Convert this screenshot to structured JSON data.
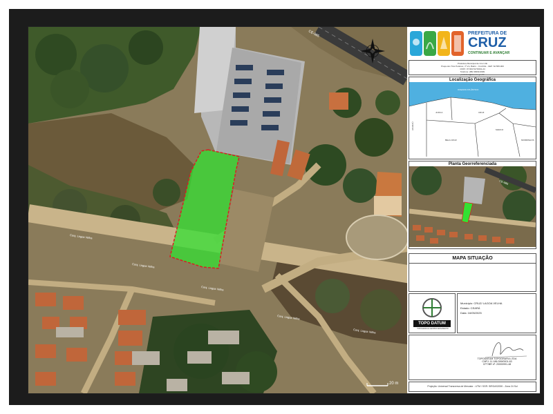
{
  "header": {
    "org_top": "PREFEITURA DE",
    "org_name": "CRUZ",
    "slogan": "CONTINUAR E AVANÇAR"
  },
  "agency_info": {
    "lines": [
      "Prefeitura Municipal de Cruz-CE",
      "Praça dos Três Poderes, nº s/n, Bairro - Cruz/CE - CEP: 62.595-000",
      "CNPJ: 07.693.517/0001-24",
      "Telefone: (88) 99999-9999",
      "prefeitura@cruz.ce.gov.br"
    ]
  },
  "geo_location": {
    "title": "Localização Geográfica",
    "labels": [
      "OCEANO ATLÂNTICO",
      "ACARAÚ",
      "JIJOCA",
      "BELA CRUZ",
      "MARCO",
      "MORRINHOS",
      "CRUZ"
    ]
  },
  "georef_plan": {
    "title": "Planta Georreferenciada",
    "road_label": "CE-085"
  },
  "situation_map": {
    "title": "MAPA SITUAÇÃO"
  },
  "company": {
    "name": "TOPO DATUM",
    "tagline": "TOPOGRAFIA E GEOPROCESSAMENTO"
  },
  "project": {
    "municipio": "Município: CRUZ/ LAGOA VELHA",
    "estado": "Estado: CEARÁ",
    "data": "Data: 16/05/2025"
  },
  "signature": {
    "lines": [
      "TOPODATUM TOPOGRAFIA LTDA",
      "CNPJ: 11.186.399/0001-63",
      "CFT/BR nº: 20000991-48"
    ]
  },
  "projection": "Projeção: Universal Transversa de Mercator - UTM / SGR: SIRGAS2000 - Zona 24 Sul",
  "map": {
    "road_top": "CE-085",
    "street_labels": [
      "Conj. Lagoa Velha",
      "Conj. Lagoa Velha",
      "Conj. Lagoa Velha",
      "Conj. Lagoa Velha",
      "Conj. Lagoa Velha"
    ],
    "scale": "20 m"
  },
  "colors": {
    "parcel_fill": "#33e033",
    "parcel_border": "#d62020",
    "brand_green": "#2e7d32",
    "brand_blue": "#1f5fa8",
    "ocean": "#4fb0e0"
  }
}
